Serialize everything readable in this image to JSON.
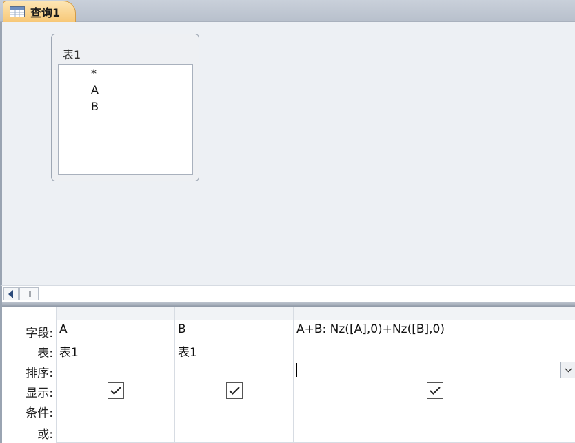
{
  "tab": {
    "label": "查询1"
  },
  "table_box": {
    "title": "表1",
    "fields": [
      "*",
      "A",
      "B"
    ]
  },
  "grid": {
    "row_labels": [
      "字段:",
      "表:",
      "排序:",
      "显示:",
      "条件:",
      "或:"
    ],
    "columns": [
      {
        "field": "A",
        "table": "表1",
        "sort": "",
        "show": true
      },
      {
        "field": "B",
        "table": "表1",
        "sort": "",
        "show": true
      },
      {
        "field": "A+B: Nz([A],0)+Nz([B],0)",
        "table": "",
        "sort": "",
        "show": true
      }
    ]
  }
}
